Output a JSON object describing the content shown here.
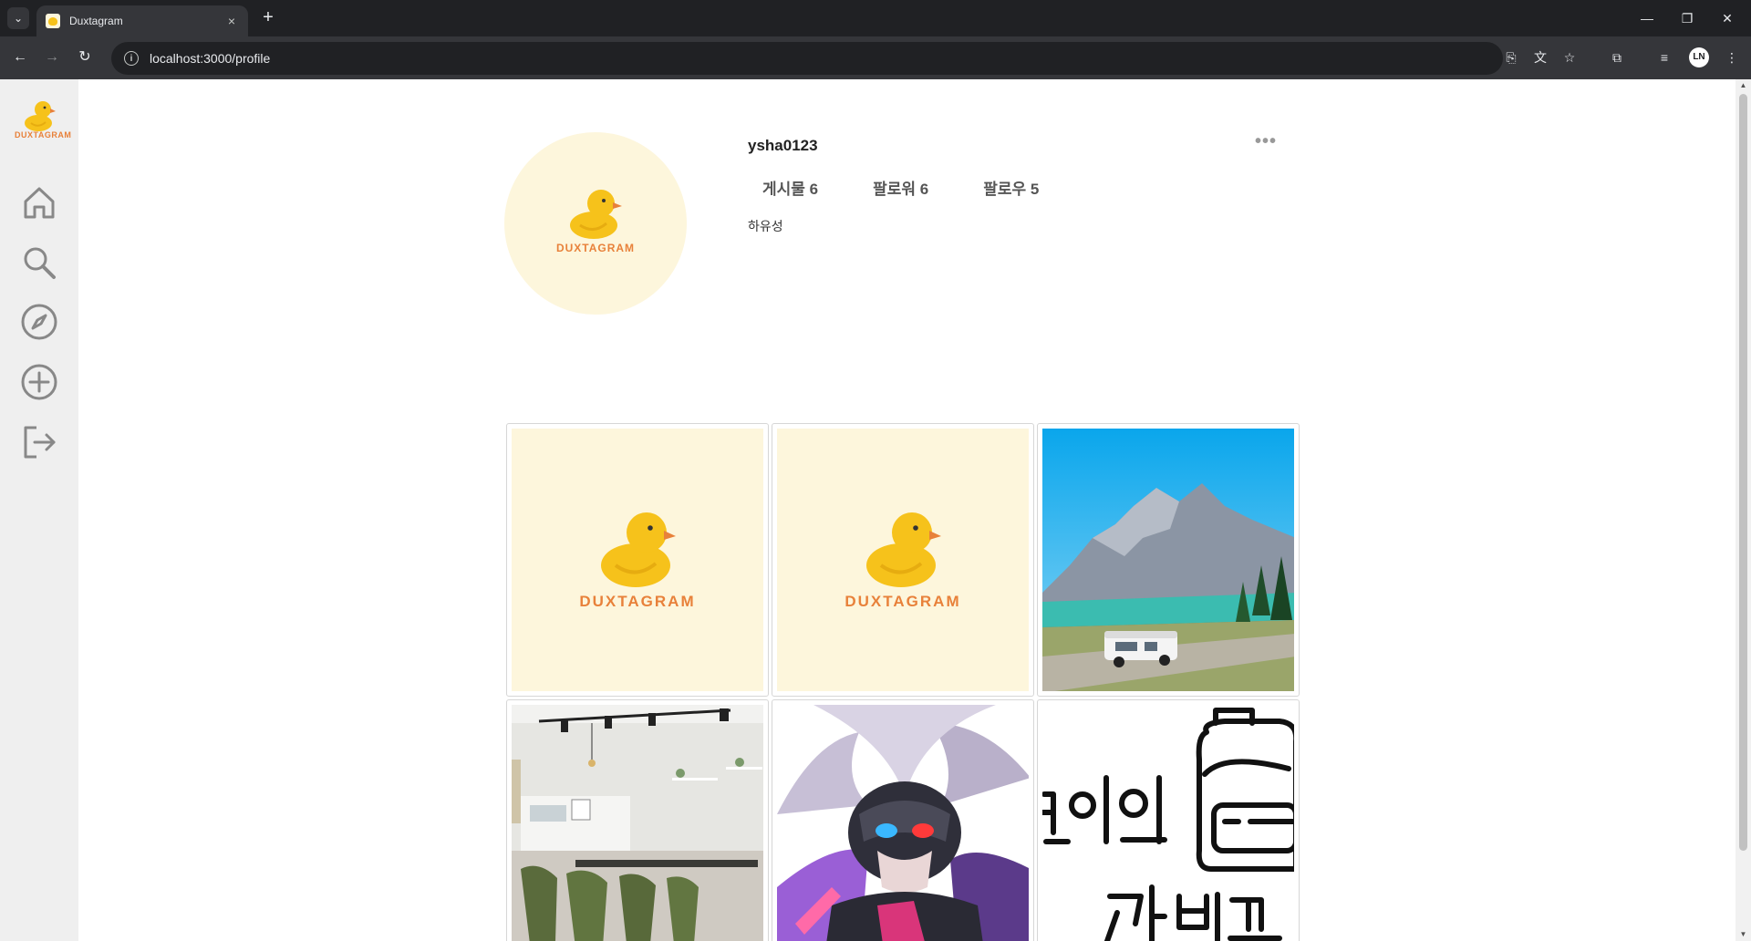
{
  "browser": {
    "tab_title": "Duxtagram",
    "url": "localhost:3000/profile",
    "tab_close": "×",
    "new_tab": "+",
    "profile_initials": "LN"
  },
  "brand": {
    "logo_text": "DUXTAGRAM"
  },
  "sidebar": {
    "items": [
      {
        "name": "home",
        "icon": "home-icon"
      },
      {
        "name": "search",
        "icon": "search-icon"
      },
      {
        "name": "explore",
        "icon": "compass-icon"
      },
      {
        "name": "create",
        "icon": "plus-circle-icon"
      },
      {
        "name": "logout",
        "icon": "logout-icon"
      }
    ]
  },
  "profile": {
    "username": "ysha0123",
    "more": "•••",
    "posts_label": "게시물 6",
    "followers_label": "팔로워 6",
    "following_label": "팔로우 5",
    "bio": "하유성"
  },
  "posts": [
    {
      "kind": "duck-logo",
      "text": "DUXTAGRAM"
    },
    {
      "kind": "duck-logo",
      "text": "DUXTAGRAM"
    },
    {
      "kind": "landscape"
    },
    {
      "kind": "cafe"
    },
    {
      "kind": "character"
    },
    {
      "kind": "handwriting",
      "text": "!이의 가방끈"
    }
  ],
  "colors": {
    "accent": "#e8813a",
    "duck_yellow": "#f6c21b",
    "cream": "#fdf6dc",
    "sidebar_bg": "#efefef"
  }
}
